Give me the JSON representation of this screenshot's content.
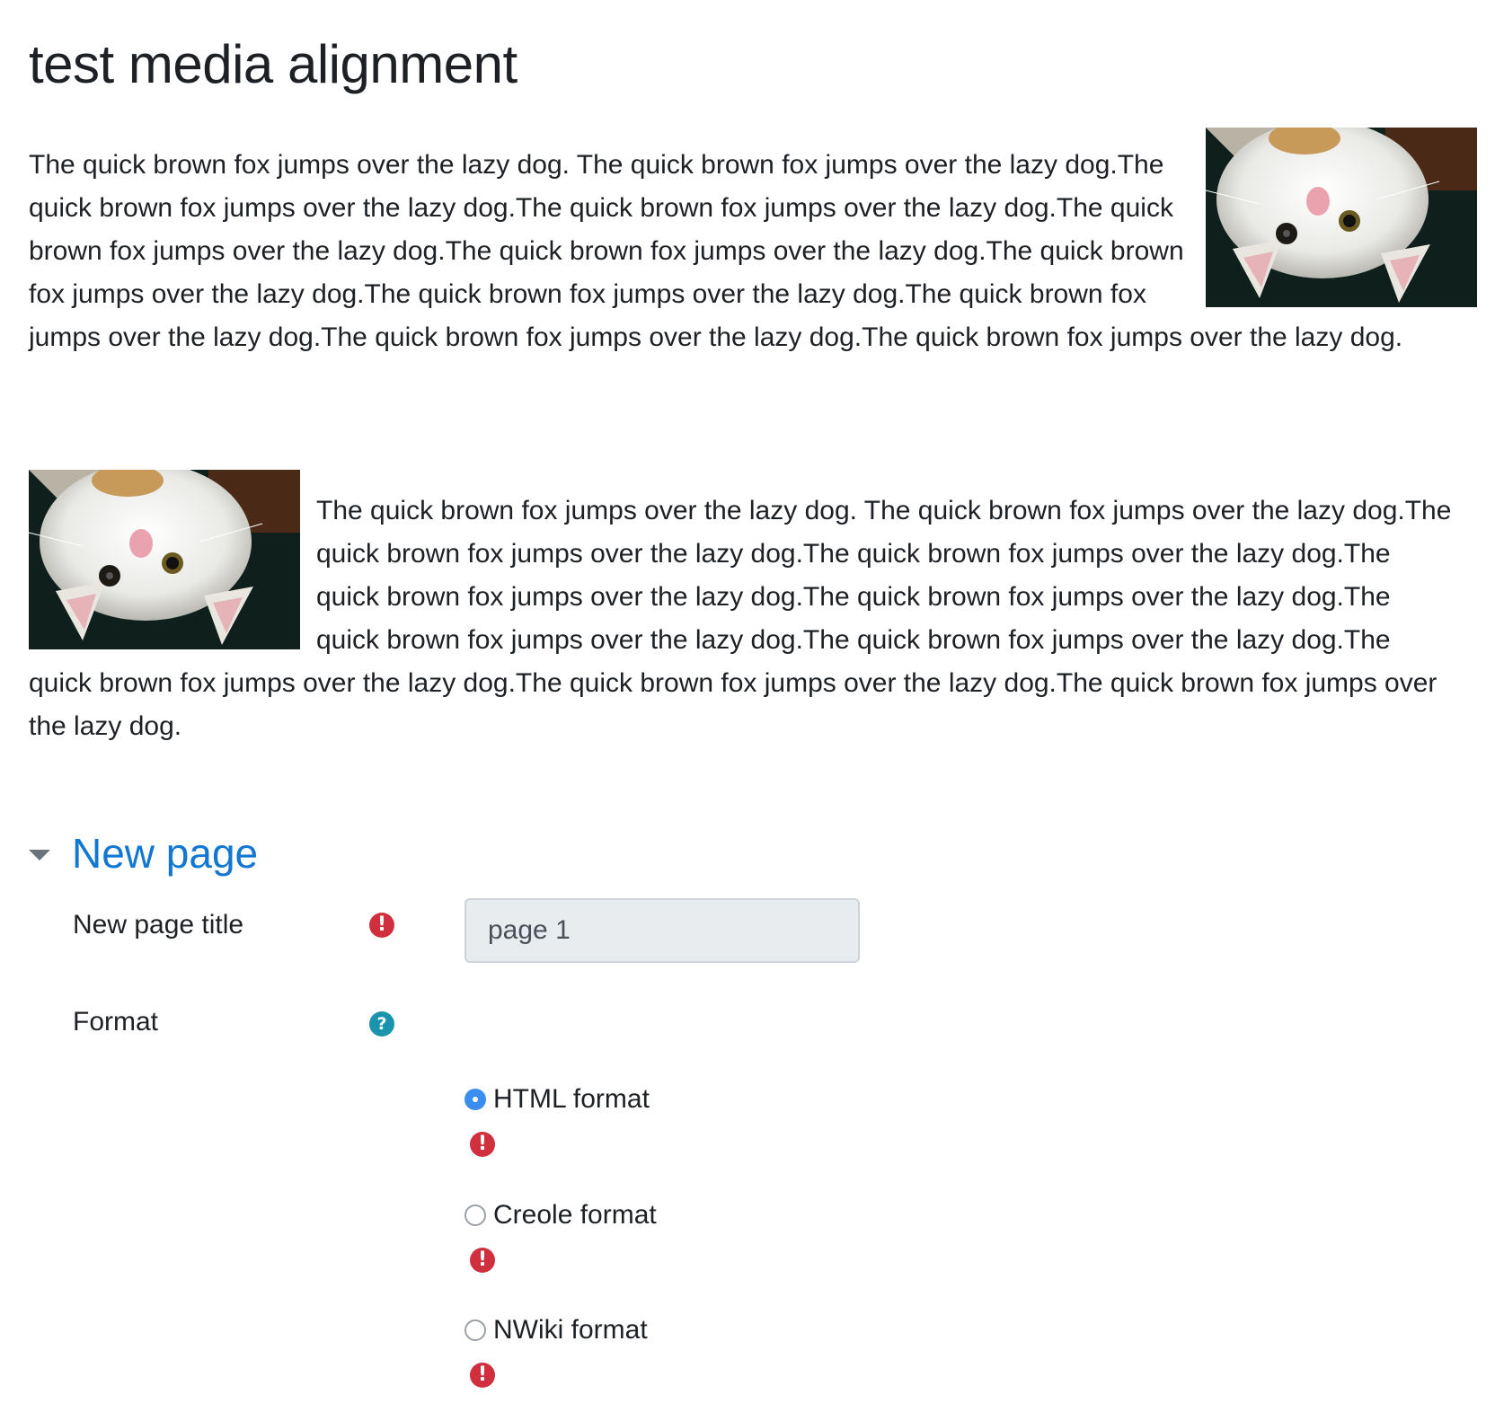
{
  "page": {
    "title": "test media alignment"
  },
  "content": {
    "paragraph_1": "The quick brown fox jumps over the lazy dog. The quick brown fox jumps over the lazy dog.The quick brown fox jumps over the lazy dog.The quick brown fox jumps over the lazy dog.The quick brown fox jumps over the lazy dog.The quick brown fox jumps over the lazy dog.The quick brown fox jumps over the lazy dog.The quick brown fox jumps over the lazy dog.The quick brown fox jumps over the lazy dog.The quick brown fox jumps over the lazy dog.The quick brown fox jumps over the lazy dog.",
    "paragraph_2": "The quick brown fox jumps over the lazy dog. The quick brown fox jumps over the lazy dog.The quick brown fox jumps over the lazy dog.The quick brown fox jumps over the lazy dog.The quick brown fox jumps over the lazy dog.The quick brown fox jumps over the lazy dog.The quick brown fox jumps over the lazy dog.The quick brown fox jumps over the lazy dog.The quick brown fox jumps over the lazy dog.The quick brown fox jumps over the lazy dog.The quick brown fox jumps over the lazy dog.",
    "image_1_alignment": "right",
    "image_2_alignment": "left"
  },
  "form": {
    "section_title": "New page",
    "section_expanded": true,
    "page_title_label": "New page title",
    "page_title_value": "page 1",
    "page_title_required": true,
    "format_label": "Format",
    "format_options": [
      {
        "label": "HTML format",
        "checked": true
      },
      {
        "label": "Creole format",
        "checked": false
      },
      {
        "label": "NWiki format",
        "checked": false
      }
    ]
  },
  "colors": {
    "accent": "#1177d1",
    "required": "#d0303d",
    "help": "#1a94ad",
    "radio_checked": "#3b8ef0",
    "input_bg": "#e9ecef"
  },
  "icons": {
    "required": "exclamation-circle-icon",
    "help": "question-circle-icon",
    "collapse": "caret-down-icon"
  }
}
